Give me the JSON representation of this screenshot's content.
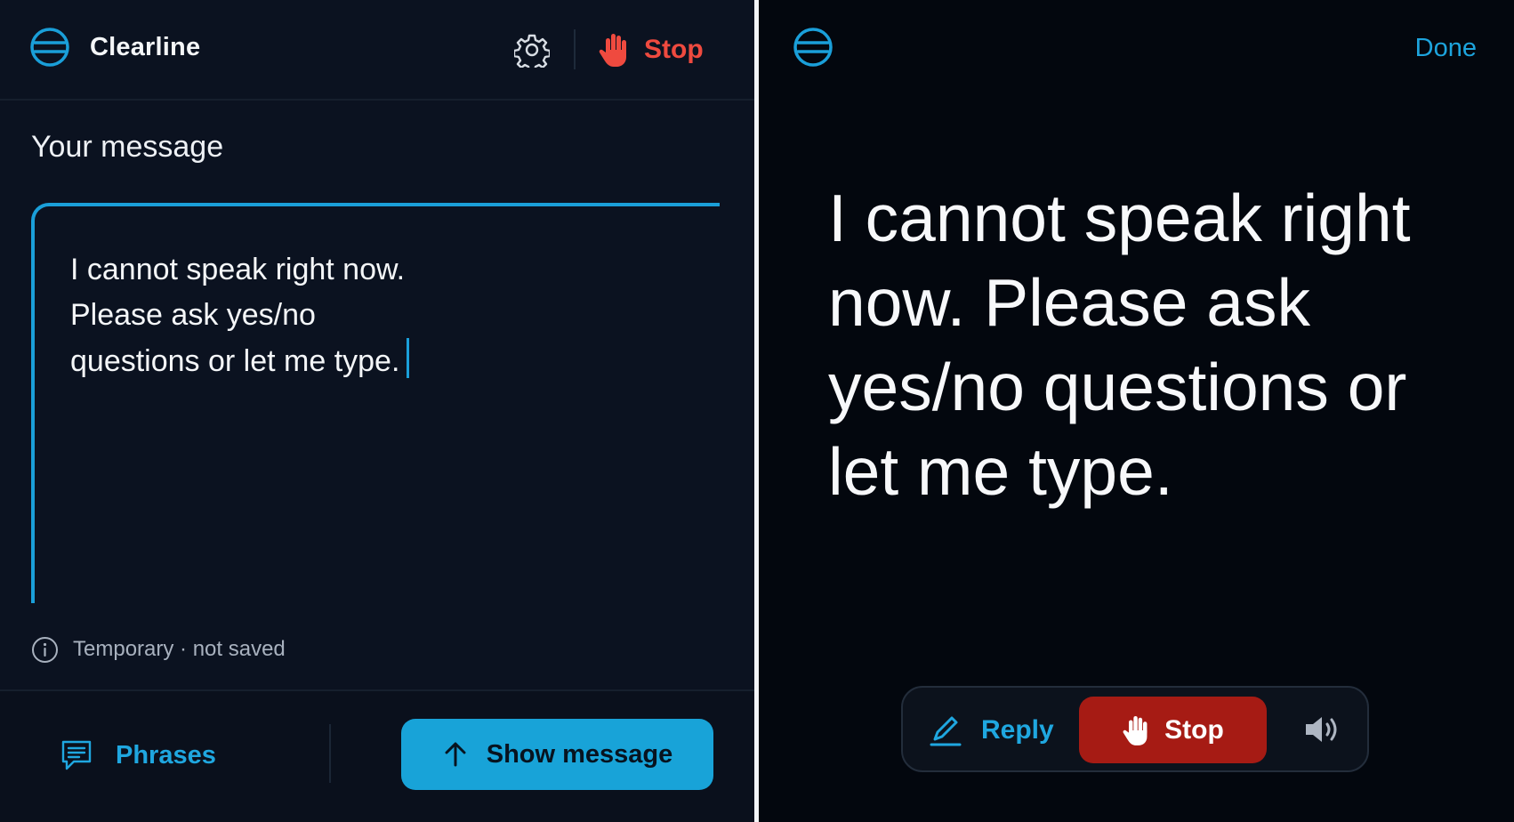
{
  "app": {
    "name": "Clearline",
    "logo_icon": "clearline-logo-icon",
    "accent_color": "#1a9fd9",
    "stop_color": "#ef4a3f"
  },
  "composer": {
    "header": {
      "settings_icon": "gear-icon",
      "stop_icon": "hand-stop-icon",
      "stop_label": "Stop"
    },
    "message_label": "Your message",
    "message_value": "I cannot speak right now.\nPlease ask yes/no\nquestions or let me type.",
    "note_icon": "info-icon",
    "note_text": "Temporary · not saved",
    "footer": {
      "phrases_icon": "chat-bubble-icon",
      "phrases_label": "Phrases",
      "show_icon": "arrow-up-icon",
      "show_label": "Show message"
    }
  },
  "display": {
    "done_label": "Done",
    "message": "I cannot speak right now.\nPlease ask yes/no questions or let me type.",
    "actions": {
      "reply_icon": "pencil-icon",
      "reply_label": "Reply",
      "stop_icon": "hand-stop-icon",
      "stop_label": "Stop",
      "stop_color": "#a61b14",
      "speak_icon": "speaker-icon"
    }
  }
}
